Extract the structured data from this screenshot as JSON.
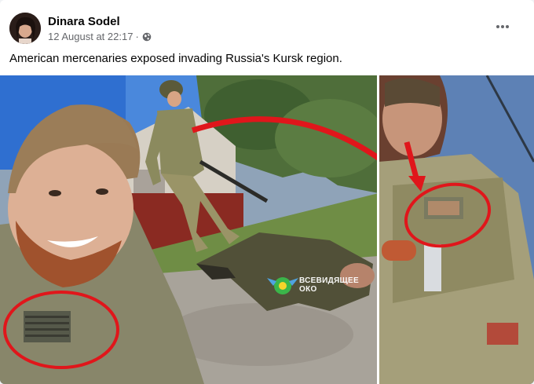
{
  "post": {
    "author": "Dinara Sodel",
    "timestamp": "12 August at 22:17",
    "separator": "·",
    "privacy_icon": "globe-icon",
    "more_icon": "more-horizontal-icon",
    "caption": "American mercenaries exposed invading Russia's Kursk region."
  },
  "photo": {
    "watermark_line1": "ВСЕВИДЯЩЕЕ",
    "watermark_line2": "ОКО",
    "watermark_icon": "eye-logo-icon"
  },
  "colors": {
    "author_text": "#050505",
    "meta_text": "#65676b",
    "annotation_red": "#e0161b"
  }
}
